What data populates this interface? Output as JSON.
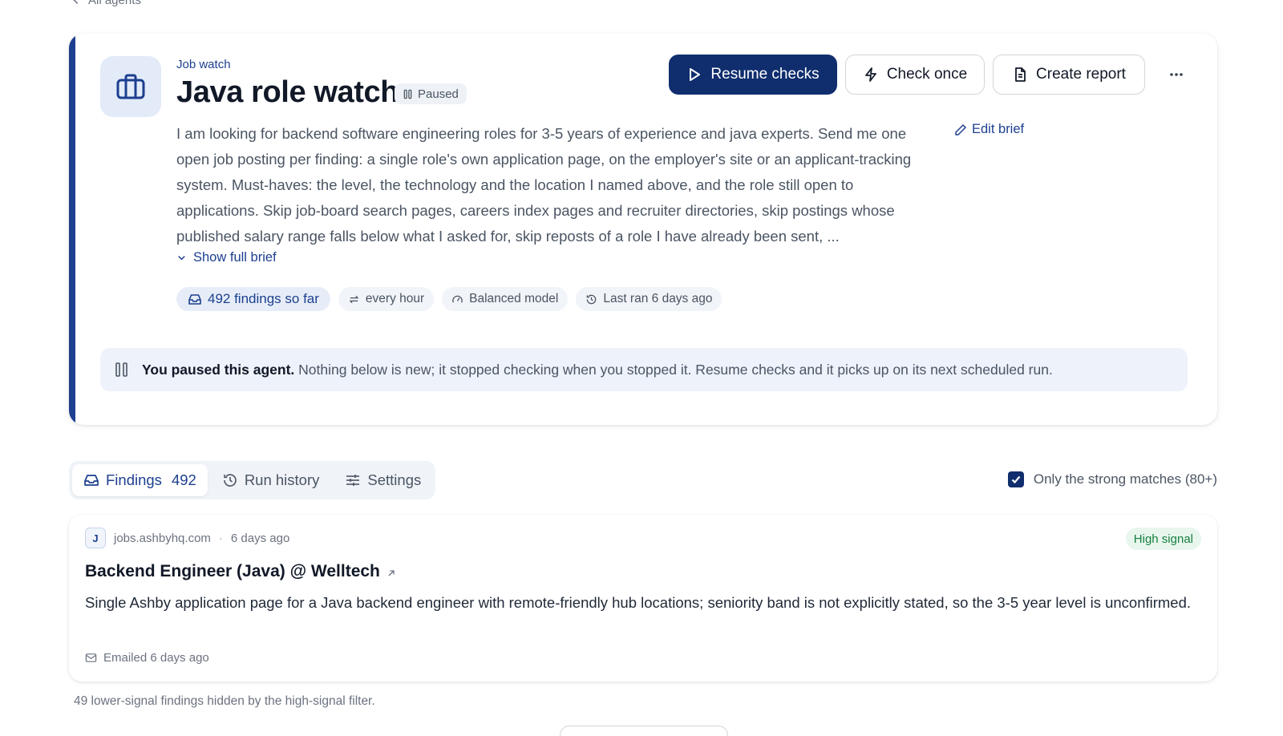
{
  "nav": {
    "back_label": "All agents"
  },
  "agent": {
    "kind": "Job watch",
    "title": "Java role watch",
    "status": "Paused",
    "brief": "I am looking for backend software engineering roles for 3-5 years of experience and java experts. Send me one open job posting per finding: a single role's own application page, on the employer's site or an applicant-tracking system. Must-haves: the level, the technology and the location I named above, and the role still open to applications. Skip job-board search pages, careers index pages and recruiter directories, skip postings whose published salary range falls below what I asked for, skip reposts of a role I have already been sent, ...",
    "edit_brief_label": "Edit brief",
    "show_brief_label": "Show full brief",
    "chips": {
      "findings": "492 findings so far",
      "schedule": "every hour",
      "model": "Balanced model",
      "last_ran": "Last ran 6 days ago"
    }
  },
  "actions": {
    "resume": "Resume checks",
    "check_once": "Check once",
    "report": "Create report"
  },
  "banner": {
    "bold": "You paused this agent.",
    "text": "Nothing below is new; it stopped checking when you stopped it. Resume checks and it picks up on its next scheduled run."
  },
  "tabs": {
    "findings": "Findings",
    "findings_count": "492",
    "history": "Run history",
    "settings": "Settings"
  },
  "filter": {
    "label": "Only the strong matches (80+)",
    "checked": true
  },
  "finding": {
    "avatar": "J",
    "source": "jobs.ashbyhq.com",
    "time": "6 days ago",
    "signal": "High signal",
    "title": "Backend Engineer (Java) @ Welltech",
    "description": "Single Ashby application page for a Java backend engineer with remote-friendly hub locations; seniority band is not explicitly stated, so the 3-5 year level is unconfirmed.",
    "emailed": "Emailed 6 days ago"
  },
  "hidden_note": "49 lower-signal findings hidden by the high-signal filter.",
  "colors": {
    "accent": "#1d3f8f",
    "primary_button": "#102e6e",
    "banner_bg": "#edf2fb",
    "signal_green": "#15803d"
  },
  "icons": {
    "agent": "briefcase-icon",
    "status": "pause-icon",
    "resume": "play-icon",
    "check": "lightning-icon",
    "report": "document-icon",
    "more": "more-horizontal-icon"
  }
}
